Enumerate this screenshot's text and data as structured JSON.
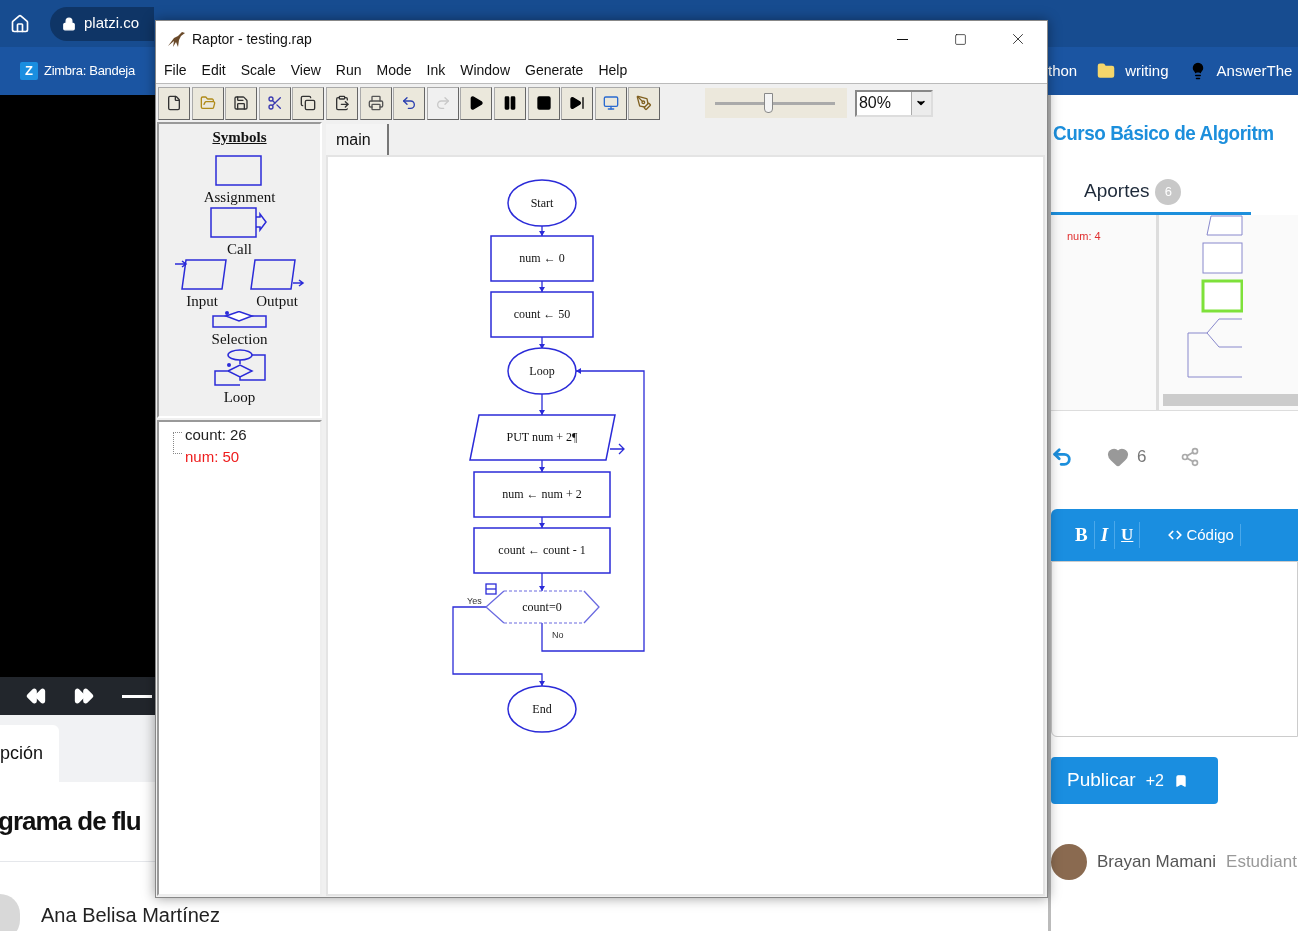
{
  "browser": {
    "url": "platzi.co",
    "bookmarks": [
      {
        "kind": "tile",
        "icon_text": "Z",
        "label": "Zimbra: Bandeja"
      },
      {
        "kind": "plain",
        "label": "thon"
      },
      {
        "kind": "folder",
        "label": "writing"
      },
      {
        "kind": "bulb",
        "label": "AnswerThe"
      }
    ]
  },
  "page": {
    "tab": "pción",
    "title": "grama de flu",
    "author": "Ana Belisa Martínez"
  },
  "sidebar": {
    "course_title": "Curso Básico de Algoritm",
    "tabs": [
      {
        "label": "Aportes",
        "count": "6",
        "selected": true
      }
    ],
    "post": {
      "screenshot_variable": "num: 4",
      "likes": "6"
    },
    "editor": {
      "tools": [
        {
          "kind": "bold",
          "label": "B"
        },
        {
          "kind": "italic",
          "label": "I"
        },
        {
          "kind": "underline",
          "label": "U"
        },
        {
          "kind": "code",
          "label": "Código"
        }
      ]
    },
    "publish": {
      "label": "Publicar",
      "points": "+2"
    },
    "comment": {
      "author": "Brayan Mamani",
      "role": "Estudiant"
    }
  },
  "raptor": {
    "title": "Raptor - testing.rap",
    "menu": [
      "File",
      "Edit",
      "Scale",
      "View",
      "Run",
      "Mode",
      "Ink",
      "Window",
      "Generate",
      "Help"
    ],
    "toolbar": [
      {
        "kind": "new",
        "disabled": false
      },
      {
        "kind": "open",
        "disabled": false
      },
      {
        "kind": "save",
        "disabled": false
      },
      {
        "kind": "cut",
        "disabled": false
      },
      {
        "kind": "copy",
        "disabled": false
      },
      {
        "kind": "paste",
        "disabled": false
      },
      {
        "kind": "print",
        "disabled": false
      },
      {
        "kind": "undo",
        "disabled": false
      },
      {
        "kind": "redo",
        "disabled": true
      },
      {
        "kind": "run",
        "disabled": false
      },
      {
        "kind": "pause",
        "disabled": false
      },
      {
        "kind": "stop",
        "disabled": false
      },
      {
        "kind": "step",
        "disabled": false
      },
      {
        "kind": "test",
        "disabled": false
      },
      {
        "kind": "pen",
        "disabled": false
      }
    ],
    "speed": {
      "level": 0.44
    },
    "zoom": "80%",
    "symbols_title": "Symbols",
    "symbols": [
      {
        "kind": "assignment",
        "label": "Assignment"
      },
      {
        "kind": "call",
        "label": "Call"
      },
      {
        "kind": "input",
        "label": "Input"
      },
      {
        "kind": "output",
        "label": "Output"
      },
      {
        "kind": "selection",
        "label": "Selection"
      },
      {
        "kind": "loop",
        "label": "Loop"
      }
    ],
    "variables": [
      {
        "text": "count: 26",
        "changed": false
      },
      {
        "text": "num: 50",
        "changed": true
      }
    ],
    "tabs": [
      {
        "label": "main",
        "selected": true
      }
    ],
    "flowchart": {
      "nodes": [
        {
          "kind": "terminal",
          "text": "Start"
        },
        {
          "kind": "assignment",
          "text": "num ← 0"
        },
        {
          "kind": "assignment",
          "text": "count ← 50"
        },
        {
          "kind": "loop",
          "text": "Loop"
        },
        {
          "kind": "output",
          "text": "PUT num + 2¶"
        },
        {
          "kind": "assignment",
          "text": "num ← num + 2"
        },
        {
          "kind": "assignment",
          "text": "count ← count - 1"
        },
        {
          "kind": "decision",
          "text": "count=0"
        },
        {
          "kind": "terminal",
          "text": "End"
        }
      ],
      "yes_label": "Yes",
      "no_label": "No"
    }
  }
}
